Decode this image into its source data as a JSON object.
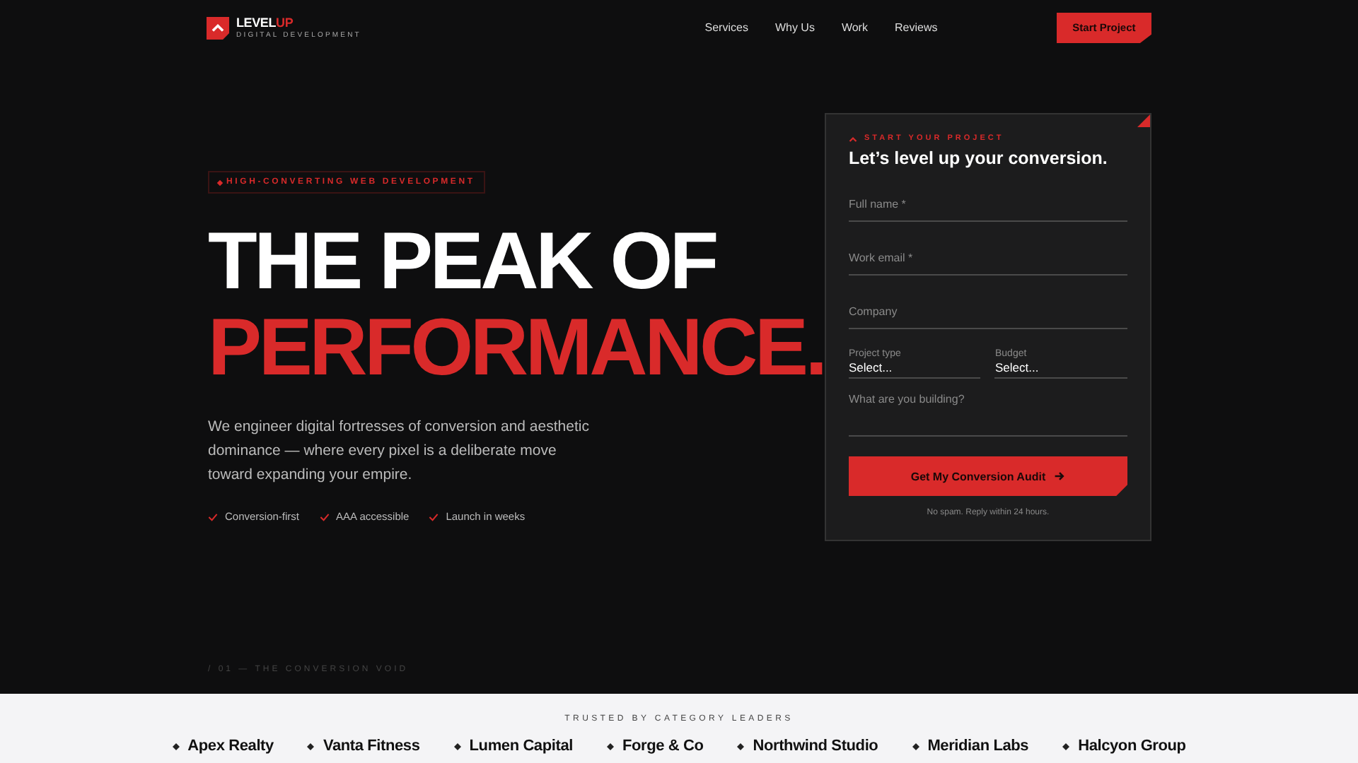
{
  "brand": {
    "name": "LEVEL",
    "name_accent": "UP",
    "tagline": "DIGITAL DEVELOPMENT"
  },
  "nav": {
    "links": [
      "Services",
      "Why Us",
      "Work",
      "Reviews"
    ],
    "cta": "Start Project"
  },
  "hero": {
    "eyebrow": "HIGH-CONVERTING WEB DEVELOPMENT",
    "title_line1": "THE PEAK OF",
    "title_line2": "PERFORMANCE.",
    "body": "We engineer digital fortresses of conversion and aesthetic dominance — where every pixel is a deliberate move toward expanding your empire.",
    "features": [
      "Conversion-first",
      "AAA accessible",
      "Launch in weeks"
    ],
    "section_marker": "/ 01 — THE CONVERSION VOID"
  },
  "form": {
    "eyebrow": "START YOUR PROJECT",
    "title": "Let’s level up your conversion.",
    "fields": [
      {
        "kind": "text",
        "placeholder": "Full name *"
      },
      {
        "kind": "text",
        "placeholder": "Work email *"
      },
      {
        "kind": "text",
        "placeholder": "Company"
      },
      {
        "kind": "select-pair",
        "items": [
          {
            "label": "Project type",
            "value": "Select..."
          },
          {
            "label": "Budget",
            "value": "Select..."
          }
        ]
      },
      {
        "kind": "textarea",
        "placeholder": "What are you building?"
      }
    ],
    "submit": "Get My Conversion Audit",
    "note": "No spam. Reply within 24 hours."
  },
  "trusted": {
    "title": "TRUSTED BY CATEGORY LEADERS",
    "logos": [
      "Apex Realty",
      "Vanta Fitness",
      "Lumen Capital",
      "Forge & Co",
      "Northwind Studio",
      "Meridian Labs",
      "Halcyon Group"
    ]
  }
}
